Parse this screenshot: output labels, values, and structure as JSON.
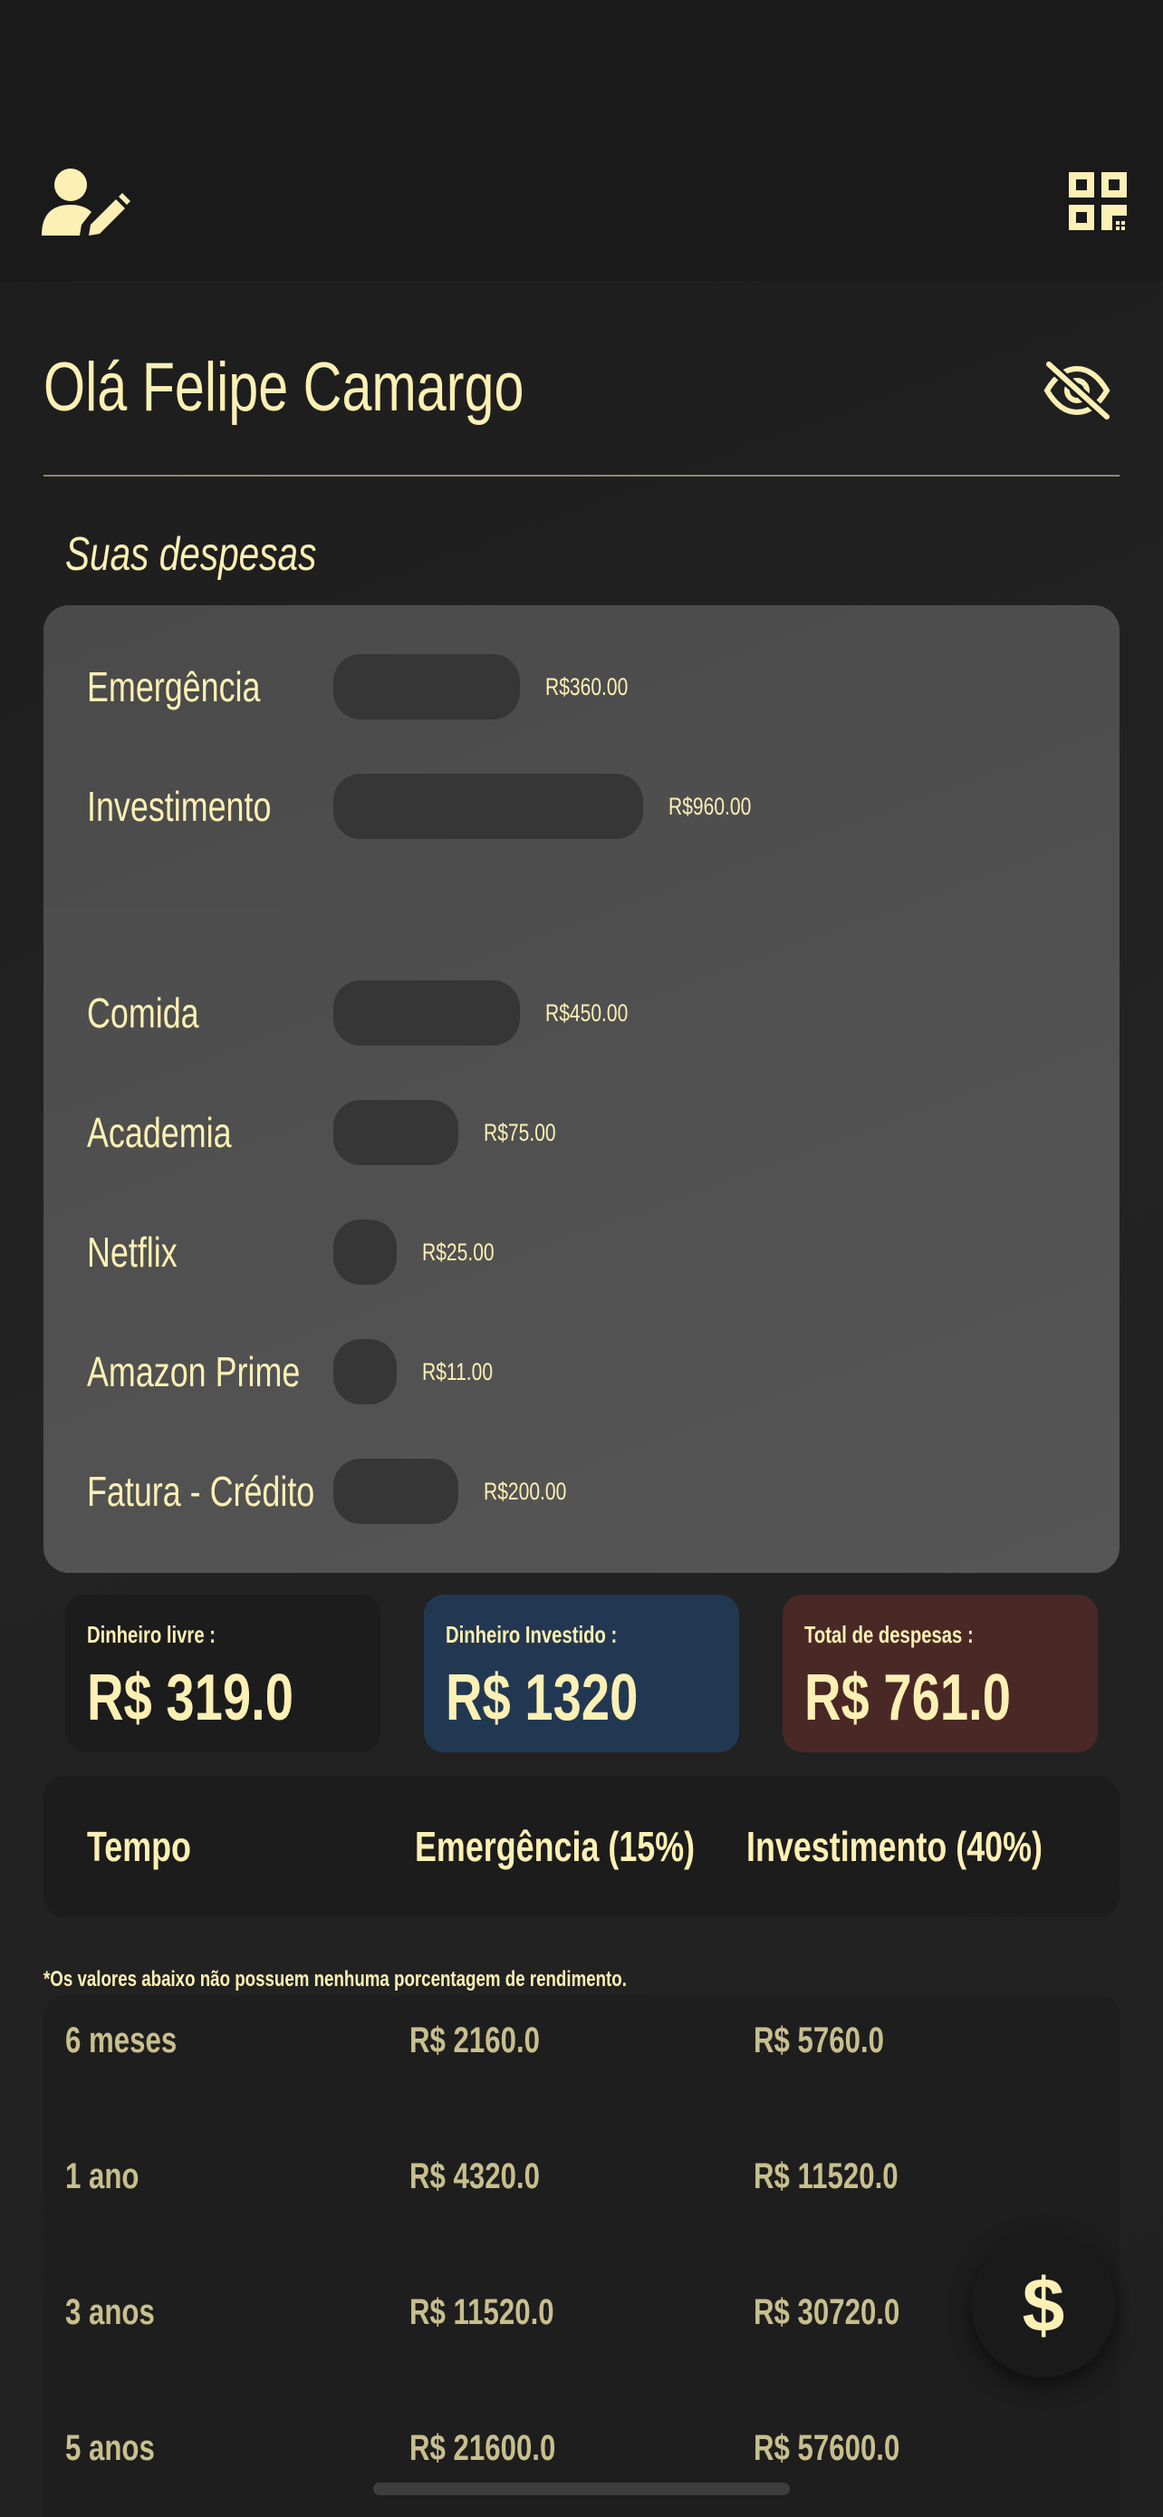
{
  "header": {
    "edit_profile_icon": "user-edit-icon",
    "qr_icon": "qr-code-icon"
  },
  "greeting": "Olá Felipe Camargo",
  "visibility_icon": "eye-off-icon",
  "section_title": "Suas despesas",
  "expenses": {
    "savings": [
      {
        "name": "Emergência",
        "amount": "R$360.00",
        "value": 360
      },
      {
        "name": "Investimento",
        "amount": "R$960.00",
        "value": 960
      }
    ],
    "items": [
      {
        "name": "Comida",
        "amount": "R$450.00",
        "value": 450
      },
      {
        "name": "Academia",
        "amount": "R$75.00",
        "value": 75
      },
      {
        "name": "Netflix",
        "amount": "R$25.00",
        "value": 25
      },
      {
        "name": "Amazon Prime",
        "amount": "R$11.00",
        "value": 11
      },
      {
        "name": "Fatura - Crédito",
        "amount": "R$200.00",
        "value": 200
      }
    ]
  },
  "stats": {
    "free": {
      "label": "Dinheiro livre :",
      "value": "R$ 319.0"
    },
    "invested": {
      "label": "Dinheiro Investido :",
      "value": "R$ 1320"
    },
    "total": {
      "label": "Total de despesas :",
      "value": "R$ 761.0"
    }
  },
  "projection": {
    "headers": [
      "Tempo",
      "Emergência (15%)",
      "Investimento (40%)"
    ],
    "note": "*Os valores abaixo não possuem nenhuma porcentagem de rendimento.",
    "rows": [
      [
        "6 meses",
        "R$ 2160.0",
        "R$ 5760.0"
      ],
      [
        "1 ano",
        "R$ 4320.0",
        "R$ 11520.0"
      ],
      [
        "3 anos",
        "R$ 11520.0",
        "R$ 30720.0"
      ],
      [
        "5 anos",
        "R$ 21600.0",
        "R$ 57600.0"
      ]
    ]
  },
  "fab": {
    "label": "$"
  },
  "colors": {
    "accent": "#fdf0b4",
    "free_card": "#1c1c1c",
    "invested_card": "#223852",
    "total_card": "#4a2826"
  }
}
